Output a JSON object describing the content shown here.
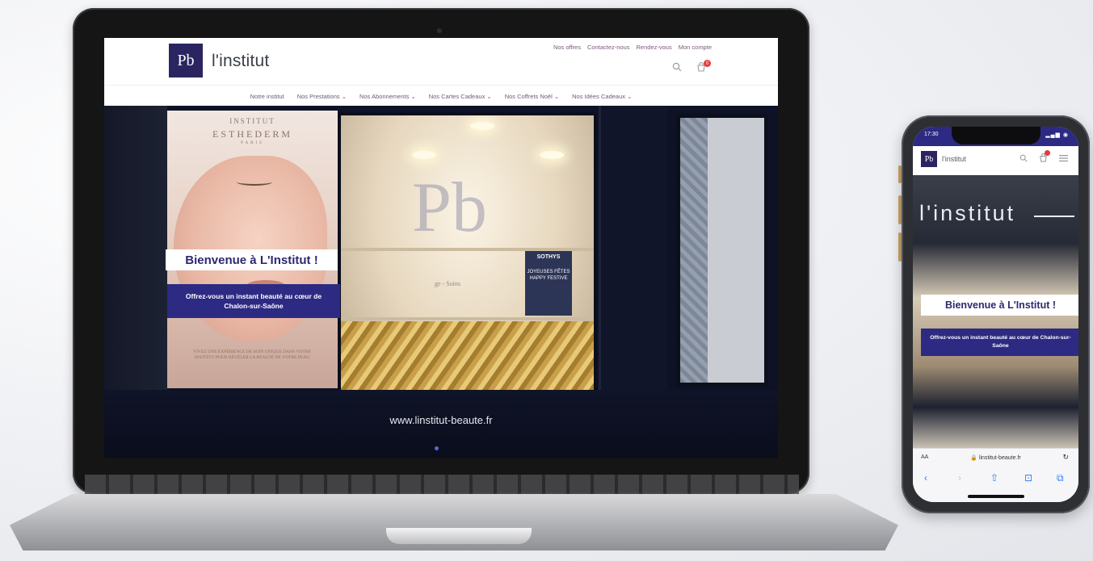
{
  "desktop": {
    "logo_mark": "Pb",
    "brand": "l'institut",
    "top_links": [
      "Nos offres",
      "Contactez-nous",
      "Rendez-vous",
      "Mon compte"
    ],
    "cart_count": "0",
    "nav": [
      {
        "label": "Notre institut"
      },
      {
        "label": "Nos Prestations ⌄"
      },
      {
        "label": "Nos Abonnements ⌄"
      },
      {
        "label": "Nos Cartes Cadeaux ⌄"
      },
      {
        "label": "Nos Coffrets Noël ⌄"
      },
      {
        "label": "Nos Idées Cadeaux ⌄"
      }
    ],
    "hero": {
      "title": "Bienvenue à L'Institut !",
      "subtitle": "Offrez-vous un instant beauté au cœur de Chalon-sur-Saône",
      "storefront_url": "www.linstitut-beaute.fr",
      "poster_brand_top": "INSTITUT",
      "poster_brand": "ESTHEDERM",
      "poster_brand_city": "PARIS",
      "poster_text": "VIVEZ UNE EXPÉRIENCE DE SOIN UNIQUE DANS VOTRE INSTITUT POUR RÉVÉLER LA BEAUTÉ DE VOTRE PEAU",
      "window_logo": "Pb",
      "window_tagline": "ge - Soins",
      "shop_box_brand": "SOTHYS",
      "shop_box_text": "JOYEUSES FÊTES HAPPY FESTIVE"
    }
  },
  "mobile": {
    "status_time": "17:30",
    "status_icons": "▂▄▆ ◉",
    "logo_mark": "Pb",
    "brand": "l'institut",
    "sign": "l'institut",
    "title": "Bienvenue à L'Institut !",
    "subtitle": "Offrez-vous un instant beauté au cœur de Chalon-sur-Saône",
    "url_aa": "AA",
    "url": "🔒 linstitut-beaute.fr",
    "reload": "↻",
    "toolbar": [
      "‹",
      "›",
      "⇧",
      "⊡",
      "⧉"
    ]
  },
  "colors": {
    "brand_purple": "#2d2a83",
    "cart_badge": "#e63a3a",
    "ios_blue": "#2f7ef6"
  }
}
